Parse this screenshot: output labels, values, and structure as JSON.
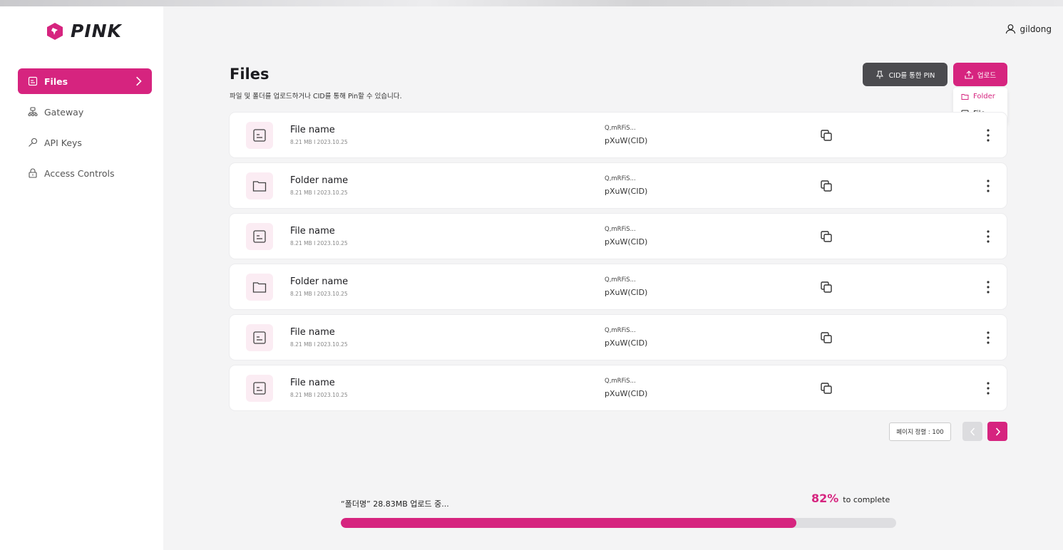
{
  "brand": {
    "name": "PINK",
    "accent": "#d6247f",
    "logo_icon": "pin-badge-icon"
  },
  "sidebar": {
    "items": [
      {
        "label": "Files",
        "icon": "file-icon",
        "active": true
      },
      {
        "label": "Gateway",
        "icon": "gateway-icon",
        "active": false
      },
      {
        "label": "API Keys",
        "icon": "key-icon",
        "active": false
      },
      {
        "label": "Access Controls",
        "icon": "lock-icon",
        "active": false
      }
    ]
  },
  "header": {
    "user": "gildong",
    "user_icon": "user-icon"
  },
  "main": {
    "title": "Files",
    "subtitle": "파일 및 폴더를 업로드하거나 CID를 통해 Pin할 수 있습니다.",
    "pin_button": "CID를 통한 PIN",
    "upload_button": "업로드",
    "upload_menu": [
      {
        "label": "Folder",
        "icon": "folder-icon",
        "selected": true
      },
      {
        "label": "File",
        "icon": "file-icon",
        "selected": false
      }
    ],
    "rows": [
      {
        "type": "file",
        "name": "File name",
        "meta": "8.21 MB  I  2023.10.25",
        "cid_line1": "Q,mRFiS...",
        "cid_line2": "pXuW(CID)"
      },
      {
        "type": "folder",
        "name": "Folder name",
        "meta": "8.21 MB  I  2023.10.25",
        "cid_line1": "Q,mRFiS...",
        "cid_line2": "pXuW(CID)"
      },
      {
        "type": "file",
        "name": "File name",
        "meta": "8.21 MB  I  2023.10.25",
        "cid_line1": "Q,mRFiS...",
        "cid_line2": "pXuW(CID)"
      },
      {
        "type": "folder",
        "name": "Folder name",
        "meta": "8.21 MB  I  2023.10.25",
        "cid_line1": "Q,mRFiS...",
        "cid_line2": "pXuW(CID)"
      },
      {
        "type": "file",
        "name": "File name",
        "meta": "8.21 MB  I  2023.10.25",
        "cid_line1": "Q,mRFiS...",
        "cid_line2": "pXuW(CID)"
      },
      {
        "type": "file",
        "name": "File name",
        "meta": "8.21 MB  I  2023.10.25",
        "cid_line1": "Q,mRFiS...",
        "cid_line2": "pXuW(CID)"
      }
    ],
    "pager": {
      "label": "페이지 정렬 : 100"
    }
  },
  "upload": {
    "status": "“폴더명” 28.83MB 업로드 중...",
    "percent": "82%",
    "percent_value": 82,
    "suffix": "to complete"
  }
}
